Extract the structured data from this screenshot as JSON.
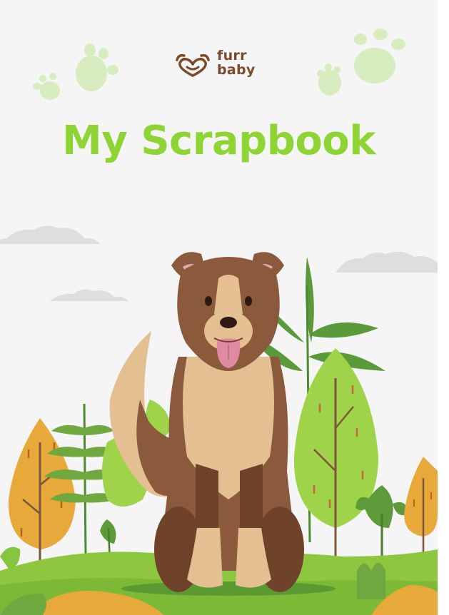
{
  "brand": {
    "logo_line1": "furr",
    "logo_line2": "baby",
    "logo_icon": "heart-paw-icon"
  },
  "title": "My Scrapbook",
  "colors": {
    "page_background": "#f5f5f5",
    "title_green": "#8fd435",
    "brand_brown": "#7a4a2b",
    "paw_green": "#d7ecbf",
    "grass_green": "#86c540",
    "tree_orange": "#e8a93b",
    "dog_brown": "#8b5a3c",
    "dog_tan": "#e3bf92"
  },
  "illustration": {
    "subject": "dog-illustration",
    "decorations": [
      "paw-print-icon",
      "cloud-icon",
      "tree-icon",
      "leaf-icon"
    ]
  }
}
